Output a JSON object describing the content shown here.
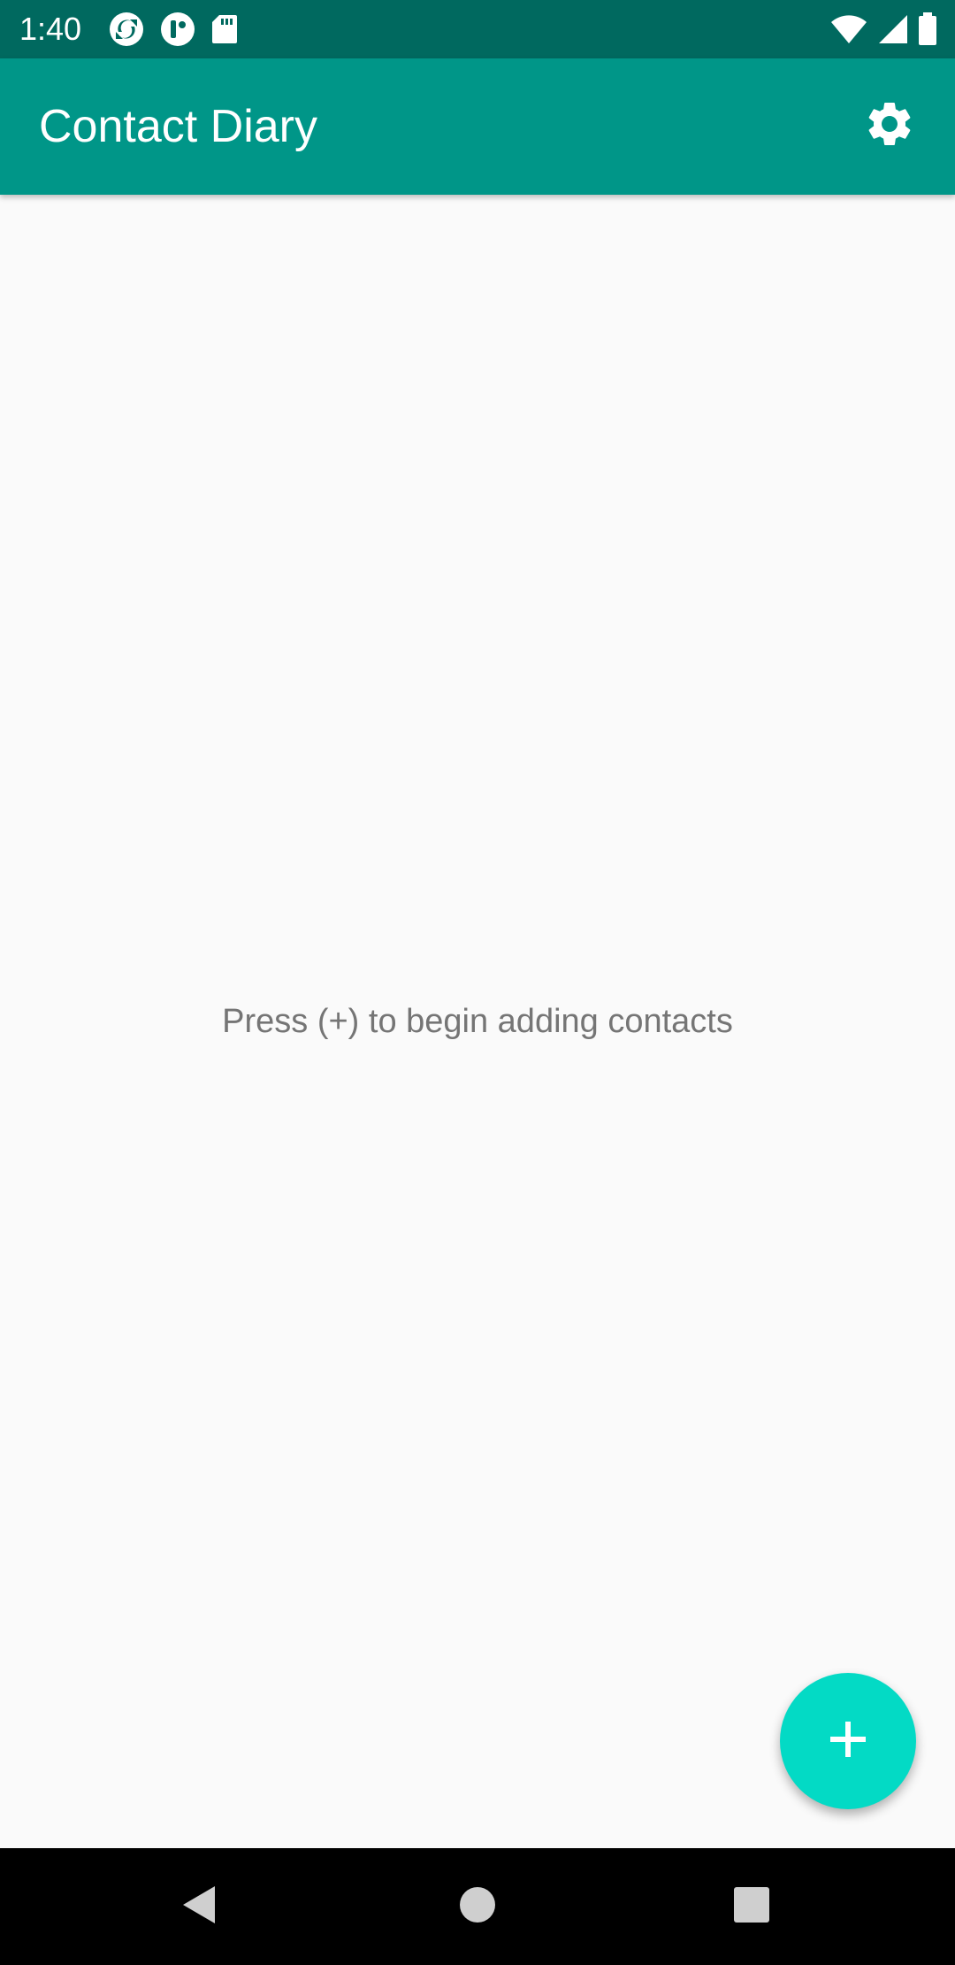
{
  "status_bar": {
    "time": "1:40",
    "left_icons": [
      "sync-icon",
      "notification-icon",
      "sd-card-icon"
    ],
    "right_icons": [
      "wifi-icon",
      "signal-icon",
      "battery-icon"
    ],
    "background_color": "#00695f"
  },
  "app_bar": {
    "title": "Contact Diary",
    "action_icon": "gear-icon",
    "background_color": "#009688"
  },
  "main": {
    "empty_message": "Press (+) to begin adding contacts"
  },
  "fab": {
    "icon": "plus-icon",
    "color": "#03dac5"
  },
  "nav_bar": {
    "buttons": [
      "back-icon",
      "home-icon",
      "recents-icon"
    ]
  }
}
